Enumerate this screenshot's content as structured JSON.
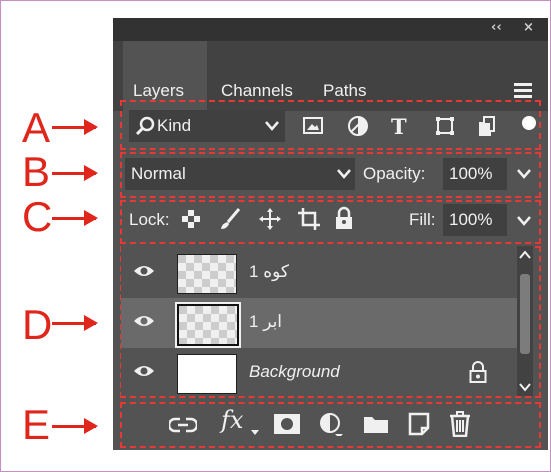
{
  "panel": {
    "tabs": [
      {
        "label": "Layers",
        "active": true
      },
      {
        "label": "Channels",
        "active": false
      },
      {
        "label": "Paths",
        "active": false
      }
    ],
    "titlebar": {
      "collapse": "‹‹",
      "close": "×"
    }
  },
  "filter": {
    "kind_label": "Kind",
    "icons": [
      "search-icon",
      "chevron-down-icon",
      "image-filter-icon",
      "adjustment-filter-icon",
      "type-filter-icon",
      "shape-filter-icon",
      "smart-object-filter-icon",
      "filter-toggle-icon"
    ]
  },
  "blend": {
    "mode": "Normal",
    "opacity_label": "Opacity:",
    "opacity_value": "100%"
  },
  "lock": {
    "lock_label": "Lock:",
    "fill_label": "Fill:",
    "fill_value": "100%",
    "icons": [
      "lock-transparent-icon",
      "lock-paint-icon",
      "lock-move-icon",
      "lock-artboard-icon",
      "lock-all-icon"
    ]
  },
  "layers": [
    {
      "name": "کوه 1",
      "selected": false,
      "italic": false,
      "thumb": "transparent"
    },
    {
      "name": "ابر 1",
      "selected": true,
      "italic": false,
      "thumb": "transparent"
    },
    {
      "name": "Background",
      "selected": false,
      "italic": true,
      "thumb": "white",
      "locked": true
    }
  ],
  "footer": {
    "icons": [
      "link-layers-icon",
      "fx-icon",
      "mask-icon",
      "adjustment-layer-icon",
      "group-folder-icon",
      "new-layer-icon",
      "trash-icon"
    ],
    "fx_text": "fx"
  },
  "annotations": {
    "labels": [
      "A",
      "B",
      "C",
      "D",
      "E"
    ],
    "color": "#e0251b"
  },
  "colors": {
    "panel_bg": "#535353",
    "titlebar_bg": "#323232",
    "tabbar_bg": "#424242",
    "field_bg": "#404040",
    "selected_row": "#6a6a6a",
    "dash": "#e53935"
  }
}
